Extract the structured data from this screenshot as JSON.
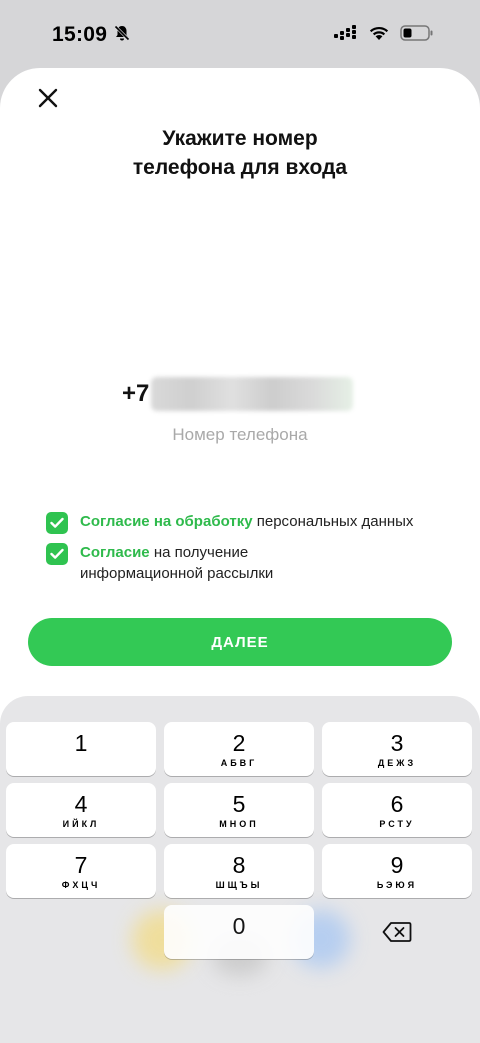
{
  "status_bar": {
    "time": "15:09",
    "icons": [
      "bell-muted-icon",
      "signal-icon",
      "wifi-icon",
      "battery-icon"
    ]
  },
  "sheet": {
    "title": "Укажите номер телефона для входа",
    "phone": {
      "prefix": "+7",
      "label": "Номер телефона"
    },
    "consents": [
      {
        "link_text": "Согласие на обработку",
        "rest_text": " персональных данных",
        "checked": true
      },
      {
        "link_text": "Согласие",
        "rest_text": " на получение информационной рассылки",
        "checked": true
      }
    ],
    "next_button": "ДАЛЕЕ"
  },
  "keyboard": {
    "keys": [
      {
        "digit": "1",
        "letters": ""
      },
      {
        "digit": "2",
        "letters": "АБВГ"
      },
      {
        "digit": "3",
        "letters": "ДЕЖЗ"
      },
      {
        "digit": "4",
        "letters": "ИЙКЛ"
      },
      {
        "digit": "5",
        "letters": "МНОП"
      },
      {
        "digit": "6",
        "letters": "РСТУ"
      },
      {
        "digit": "7",
        "letters": "ФХЦЧ"
      },
      {
        "digit": "8",
        "letters": "ШЩЪЫ"
      },
      {
        "digit": "9",
        "letters": "ЬЭЮЯ"
      },
      {
        "digit": "0",
        "letters": ""
      }
    ]
  },
  "colors": {
    "accent": "#33c955",
    "link": "#2fba4c",
    "placeholder": "#a9a9a9"
  }
}
